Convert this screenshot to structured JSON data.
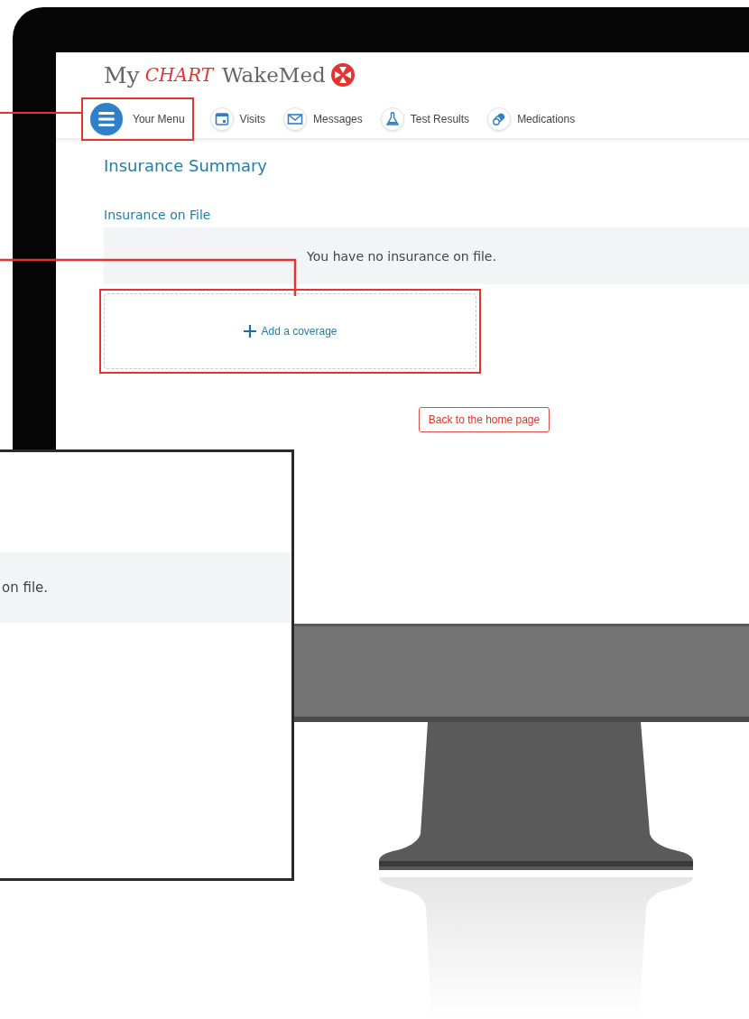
{
  "logo": {
    "prefix": "My",
    "script": "CHART",
    "brand": "WakeMed"
  },
  "nav": [
    {
      "kind": "menu",
      "label": "Your Menu",
      "highlighted": true
    },
    {
      "kind": "calendar",
      "label": "Visits",
      "highlighted": false
    },
    {
      "kind": "envelope",
      "label": "Messages",
      "highlighted": false
    },
    {
      "kind": "flask",
      "label": "Test Results",
      "highlighted": false
    },
    {
      "kind": "pills",
      "label": "Medications",
      "highlighted": false
    }
  ],
  "page_title": "Insurance Summary",
  "section_title": "Insurance on File",
  "empty_message": "You have no insurance on file.",
  "add_coverage": {
    "label": "Add a coverage",
    "highlighted": true
  },
  "back_button": "Back to the home page",
  "zoom_panel": {
    "text": "on file."
  }
}
